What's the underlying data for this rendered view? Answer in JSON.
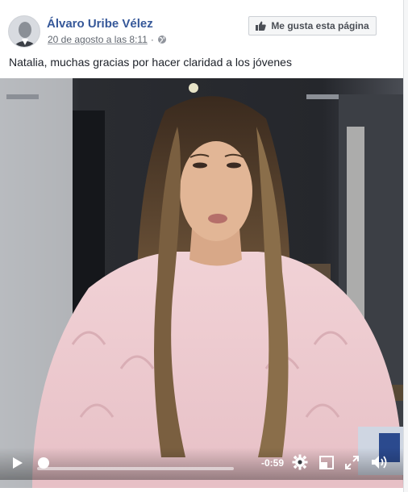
{
  "post": {
    "page_name": "Álvaro Uribe Vélez",
    "timestamp": "20 de agosto a las 8:11",
    "audience_icon": "globe-icon",
    "like_page_label": "Me gusta esta página",
    "like_icon": "thumbs-up-icon",
    "text": "Natalia, muchas gracias por hacer claridad a los jóvenes"
  },
  "video": {
    "time_remaining": "-0:59",
    "progress": 0.0,
    "icons": [
      "play-icon",
      "settings-icon",
      "fullscreen-icon",
      "expand-icon",
      "volume-icon"
    ]
  },
  "colors": {
    "link": "#365899",
    "text": "#1d2129",
    "meta": "#616770",
    "background": "#e9ebee"
  }
}
